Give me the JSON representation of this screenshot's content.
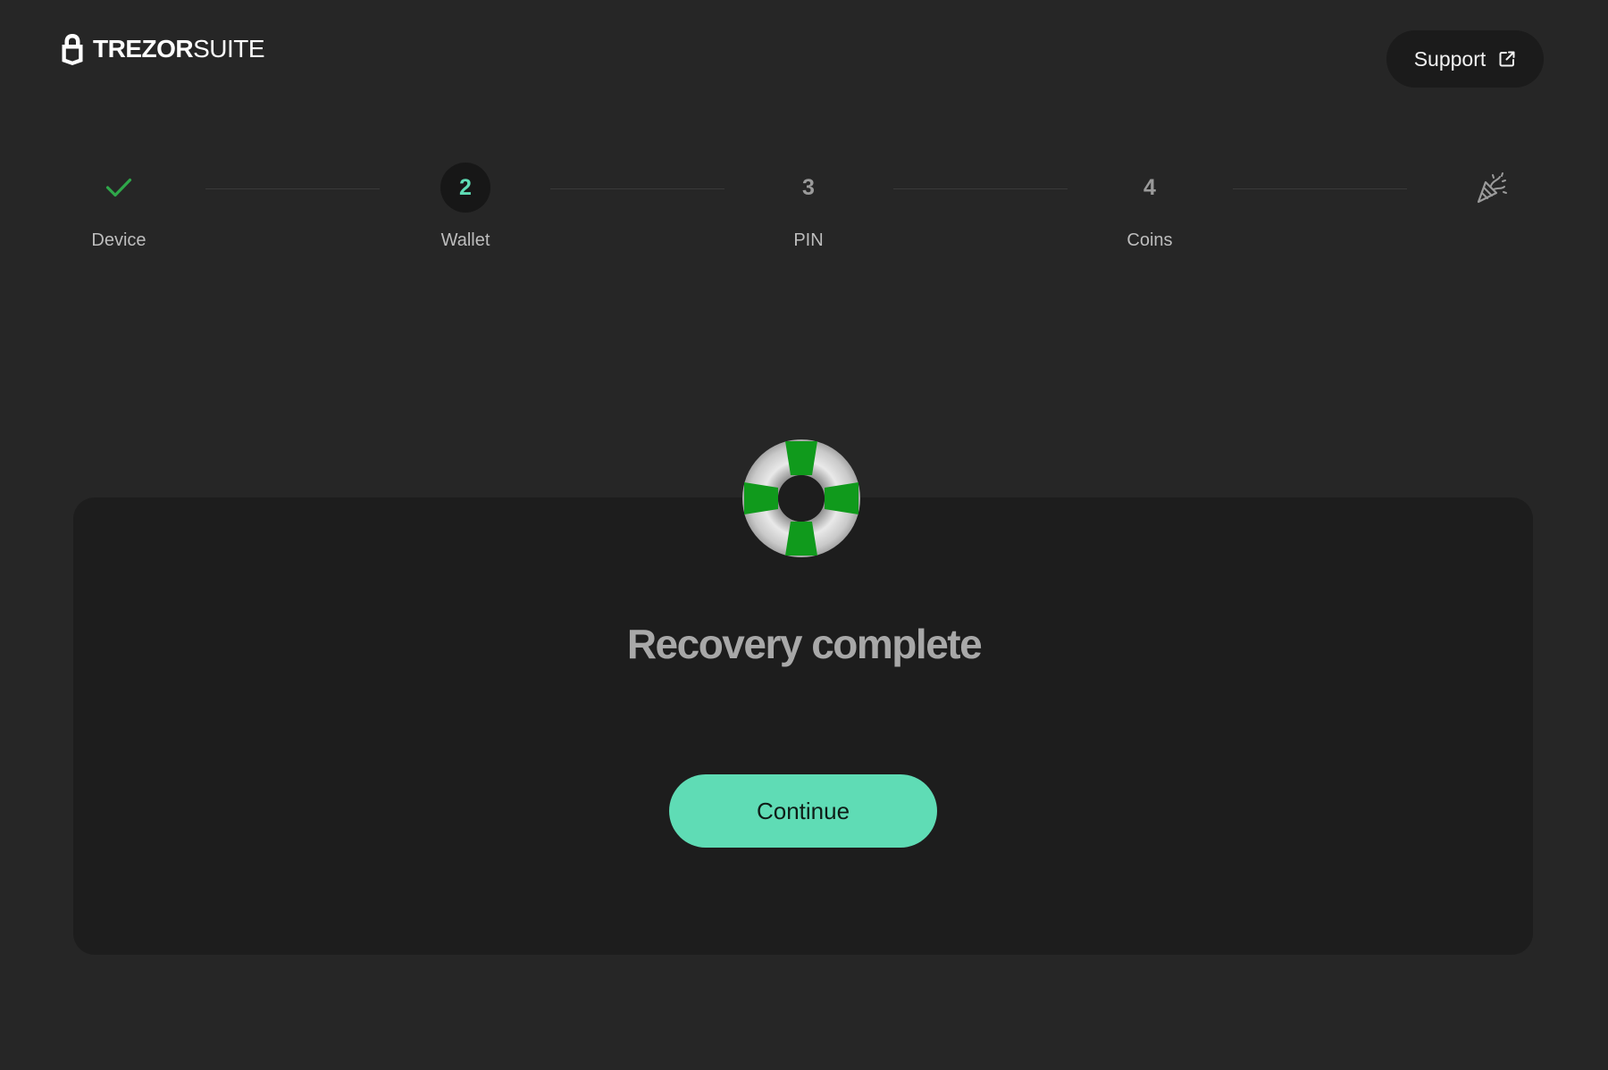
{
  "header": {
    "logo_brand": "TREZOR",
    "logo_product": "SUITE",
    "support_label": "Support",
    "support_icon": "external-link-icon"
  },
  "stepper": {
    "steps": [
      {
        "label": "Device",
        "marker": "",
        "state": "completed",
        "icon": "check-icon"
      },
      {
        "label": "Wallet",
        "marker": "2",
        "state": "active"
      },
      {
        "label": "PIN",
        "marker": "3",
        "state": "upcoming"
      },
      {
        "label": "Coins",
        "marker": "4",
        "state": "upcoming"
      },
      {
        "label": "",
        "marker": "",
        "state": "upcoming",
        "icon": "party-popper-icon"
      }
    ]
  },
  "main": {
    "illustration": "lifebuoy-icon",
    "title": "Recovery complete",
    "continue_label": "Continue"
  },
  "colors": {
    "background": "#262626",
    "card": "#1d1d1d",
    "accent": "#5fdcb5",
    "success": "#2fa74a",
    "lifebuoy_green": "#109a1c"
  }
}
